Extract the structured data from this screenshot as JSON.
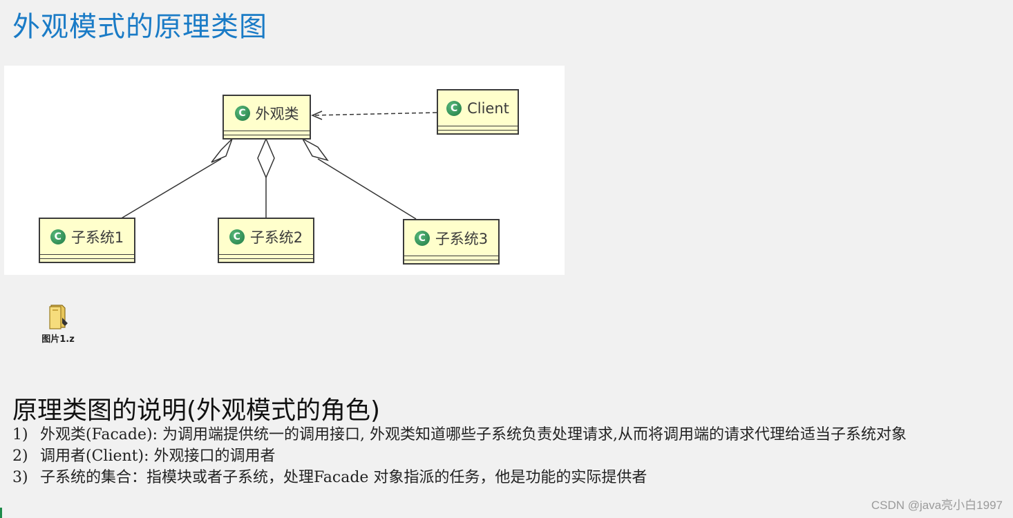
{
  "page_title": "外观模式的原理类图",
  "diagram": {
    "icon_letter": "C",
    "classes": {
      "facade": "外观类",
      "client": "Client",
      "subsystem1": "子系统1",
      "subsystem2": "子系统2",
      "subsystem3": "子系统3"
    }
  },
  "attachment": {
    "icon": "file-icon",
    "label": "图片1.z"
  },
  "section_title": "原理类图的说明(外观模式的角色)",
  "notes": [
    {
      "num": "1)",
      "text": "外观类(Facade): 为调用端提供统一的调用接口, 外观类知道哪些子系统负责处理请求,从而将调用端的请求代理给适当子系统对象"
    },
    {
      "num": "2)",
      "text": "调用者(Client): 外观接口的调用者"
    },
    {
      "num": "3)",
      "text": "子系统的集合：指模块或者子系统，处理Facade 对象指派的任务，他是功能的实际提供者"
    }
  ],
  "watermark": "CSDN @java亮小白1997"
}
